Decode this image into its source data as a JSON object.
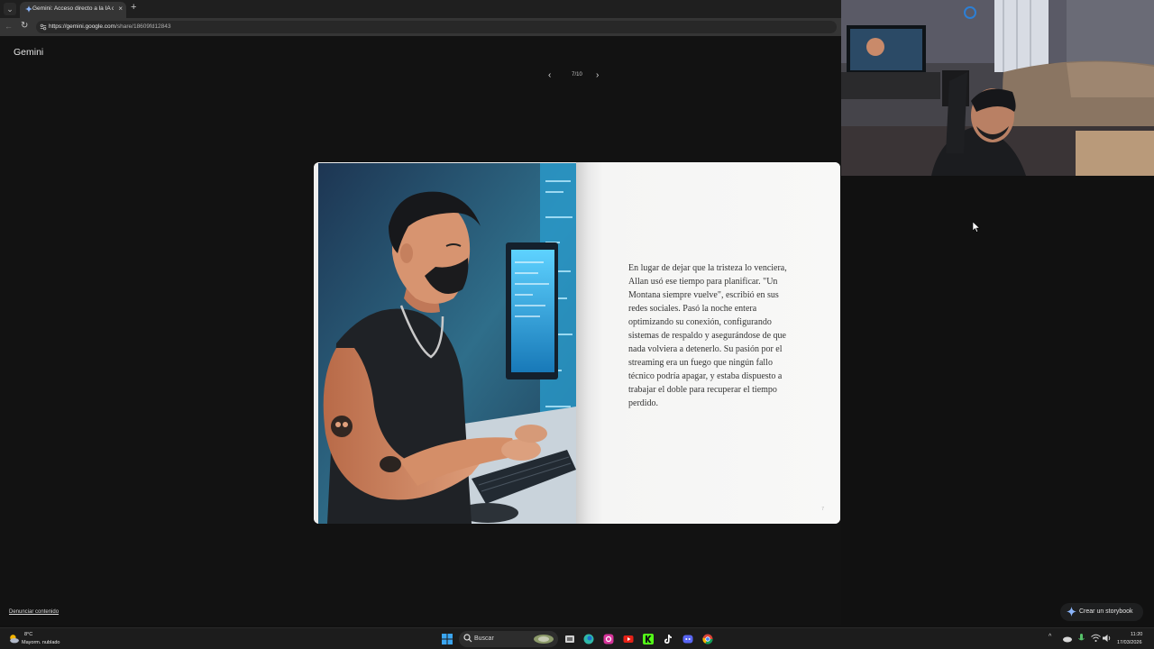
{
  "browser": {
    "tab_title": "Gemini: Acceso directo a la IA de Google",
    "url_host": "https://gemini.google.com",
    "url_path": "/share/18609fd12843",
    "new_tab_label": "+",
    "close_tab_label": "×"
  },
  "page": {
    "brand": "Gemini",
    "pager_label": "7/10",
    "story_text": "En lugar de dejar que la tristeza lo venciera, Allan usó ese tiempo para planificar. \"Un Montana siempre vuelve\", escribió en sus redes sociales. Pasó la noche entera optimizando su conexión, configurando sistemas de respaldo y asegurándose de que nada volviera a detenerlo. Su pasión por el streaming era un fuego que ningún fallo técnico podría apagar, y estaba dispuesto a trabajar el doble para recuperar el tiempo perdido.",
    "page_number": "7",
    "report_link": "Denunciar contenido",
    "create_button": "Crear un storybook"
  },
  "taskbar": {
    "weather_temp": "8°C",
    "weather_desc": "Mayorm. nublado",
    "search_placeholder": "Buscar",
    "time": "11:20",
    "date": "17/03/2026"
  },
  "colors": {
    "page_bg": "#121212",
    "book_page": "#f6f5f3",
    "story_text": "#333333",
    "accent_blue": "#3aa5d8"
  },
  "icons": [
    "tab-list-icon",
    "gemini-favicon-icon",
    "close-icon",
    "plus-icon",
    "back-icon",
    "reload-icon",
    "site-info-icon",
    "chevron-left-icon",
    "chevron-right-icon",
    "sparkle-icon",
    "windows-start-icon",
    "search-icon",
    "cursor-icon"
  ]
}
